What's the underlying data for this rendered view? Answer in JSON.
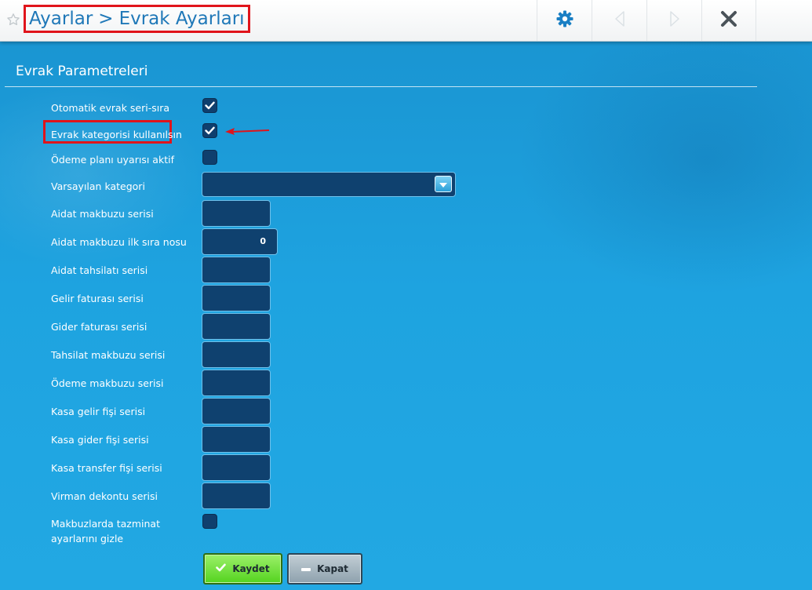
{
  "header": {
    "breadcrumb": [
      "Ayarlar",
      ">",
      "Evrak Ayarları"
    ],
    "buttons": {
      "settings": "gear-icon",
      "back": "triangle-left-icon",
      "forward": "triangle-right-icon",
      "close": "close-icon"
    }
  },
  "section": {
    "title": "Evrak Parametreleri"
  },
  "form": {
    "auto_serial": {
      "label": "Otomatik evrak seri-sıra",
      "checked": true
    },
    "use_category": {
      "label": "Evrak kategorisi kullanılsın",
      "checked": true
    },
    "payment_plan_warning": {
      "label": "Ödeme planı uyarısı aktif",
      "checked": false
    },
    "default_category": {
      "label": "Varsayılan kategori",
      "value": ""
    },
    "dues_receipt_series": {
      "label": "Aidat makbuzu serisi",
      "value": ""
    },
    "dues_receipt_first_no": {
      "label": "Aidat makbuzu ilk sıra nosu",
      "value": "0"
    },
    "dues_collection_series": {
      "label": "Aidat tahsilatı serisi",
      "value": ""
    },
    "income_invoice_series": {
      "label": "Gelir faturası serisi",
      "value": ""
    },
    "expense_invoice_series": {
      "label": "Gider faturası serisi",
      "value": ""
    },
    "collection_receipt_series": {
      "label": "Tahsilat makbuzu serisi",
      "value": ""
    },
    "payment_receipt_series": {
      "label": "Ödeme makbuzu serisi",
      "value": ""
    },
    "cash_income_slip_series": {
      "label": "Kasa gelir fişi serisi",
      "value": ""
    },
    "cash_expense_slip_series": {
      "label": "Kasa gider fişi serisi",
      "value": ""
    },
    "cash_transfer_slip_series": {
      "label": "Kasa transfer fişi serisi",
      "value": ""
    },
    "transfer_voucher_series": {
      "label": "Virman dekontu serisi",
      "value": ""
    },
    "hide_compensation": {
      "label": "Makbuzlarda tazminat ayarlarını gizle",
      "checked": false
    }
  },
  "actions": {
    "save": "Kaydet",
    "close": "Kapat"
  },
  "colors": {
    "accent": "#1aa3dd",
    "highlight": "#e0141b",
    "save": "#54d31f",
    "field": "#0f416f"
  }
}
